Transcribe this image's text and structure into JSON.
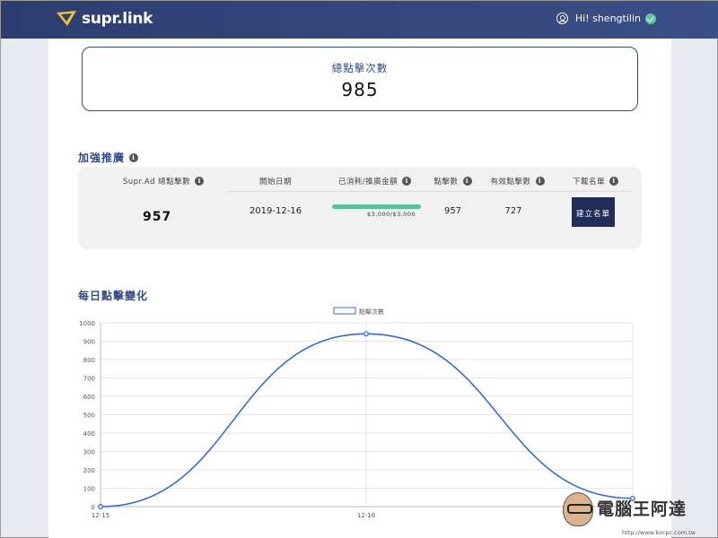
{
  "app": {
    "logo_text": "supr.link",
    "brand_color": "#2c3e70",
    "greeting": "Hi! shengtilin"
  },
  "total_clicks": {
    "label": "總點擊次數",
    "value": "985"
  },
  "promo": {
    "section_title": "加強推廣",
    "headers": {
      "suprad_clicks": "Supr.Ad 總點擊數",
      "start_date": "開始日期",
      "spent_budget": "已消耗/推廣金額",
      "clicks": "點擊數",
      "valid_clicks": "有效點擊數",
      "download_list": "下載名單"
    },
    "row": {
      "suprad_clicks": "957",
      "start_date": "2019-12-16",
      "spent_text": "$3,000/$3,000",
      "spent_fraction": 1.0,
      "clicks": "957",
      "valid_clicks": "727",
      "build_button": "建立名單"
    }
  },
  "daily": {
    "section_title": "每日點擊變化"
  },
  "chart_data": {
    "type": "line",
    "title": "",
    "x": [
      "12-15",
      "12-16",
      ""
    ],
    "series": [
      {
        "name": "點擊次數",
        "values": [
          0,
          940,
          45
        ],
        "color": "#2f6fd6"
      }
    ],
    "ylim": [
      0,
      1000
    ],
    "yticks": [
      0,
      100,
      200,
      300,
      400,
      500,
      600,
      700,
      800,
      900,
      1000
    ],
    "legend_position": "top-center",
    "grid": true
  },
  "watermark": {
    "text": "電腦王阿達",
    "url": "http://www.kocpc.com.tw"
  }
}
